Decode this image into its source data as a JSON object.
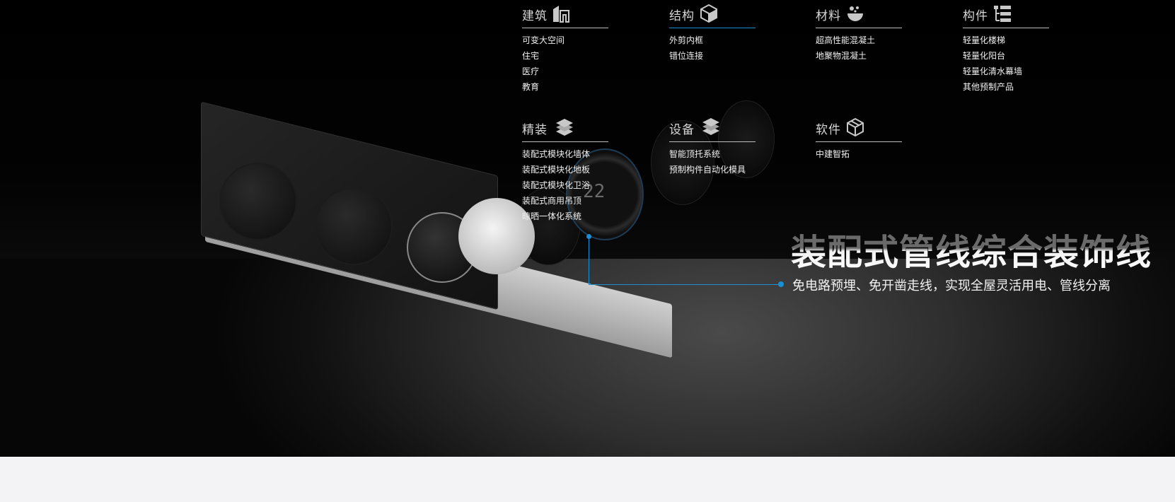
{
  "categories": [
    {
      "title": "建筑",
      "icon": "building-icon",
      "items": [
        "可变大空间",
        "住宅",
        "医疗",
        "教育"
      ]
    },
    {
      "title": "结构",
      "icon": "cube-icon",
      "items": [
        "外剪内框",
        "错位连接"
      ]
    },
    {
      "title": "材料",
      "icon": "material-icon",
      "items": [
        "超高性能混凝土",
        "地聚物混凝土"
      ]
    },
    {
      "title": "构件",
      "icon": "tree-list-icon",
      "items": [
        "轻量化楼梯",
        "轻量化阳台",
        "轻量化清水幕墙",
        "其他预制产品"
      ]
    },
    {
      "title": "精装",
      "icon": "layers-icon",
      "items": [
        "装配式模块化墙体",
        "装配式模块化地板",
        "装配式模块化卫浴",
        "装配式商用吊顶",
        "晾晒一体化系统"
      ]
    },
    {
      "title": "设备",
      "icon": "stack-icon",
      "items": [
        "智能顶托系统",
        "预制构件自动化模具"
      ]
    },
    {
      "title": "软件",
      "icon": "box-icon",
      "items": [
        "中建智拓"
      ]
    }
  ],
  "feature": {
    "title": "装配式管线综合装饰线",
    "subtitle": "免电路预埋、免开凿走线，实现全屋灵活用电、管线分离"
  },
  "product_display": {
    "thermostat_reading": "22"
  },
  "colors": {
    "accent": "#1a8fd6",
    "background_top": "#000000",
    "background_bottom": "#f3f3f5"
  }
}
